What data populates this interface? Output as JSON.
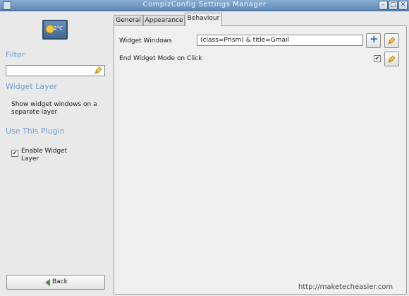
{
  "window": {
    "title": "CompizConfig Settings Manager",
    "controls": [
      "–",
      "□",
      "✕"
    ]
  },
  "sidebar": {
    "plugin_icon_text": "2°C",
    "filter_heading": "Filter",
    "filter_value": "",
    "plugin_heading": "Widget Layer",
    "plugin_description": "Show widget windows on a separate layer",
    "use_heading": "Use This Plugin",
    "enable_label": "Enable Widget Layer",
    "enable_checked": true,
    "back_label": "Back"
  },
  "tabs": [
    {
      "label": "General",
      "active": false
    },
    {
      "label": "Appearance",
      "active": false
    },
    {
      "label": "Behaviour",
      "active": true
    }
  ],
  "settings": [
    {
      "label": "Widget Windows",
      "value": "(class=Prism) & title=Gmail"
    },
    {
      "label": "End Widget Mode on Click",
      "checked": true
    }
  ],
  "watermark": "http://maketecheasier.com",
  "colors": {
    "heading": "#6f9ed4",
    "titlebar": "#5d87b4"
  }
}
